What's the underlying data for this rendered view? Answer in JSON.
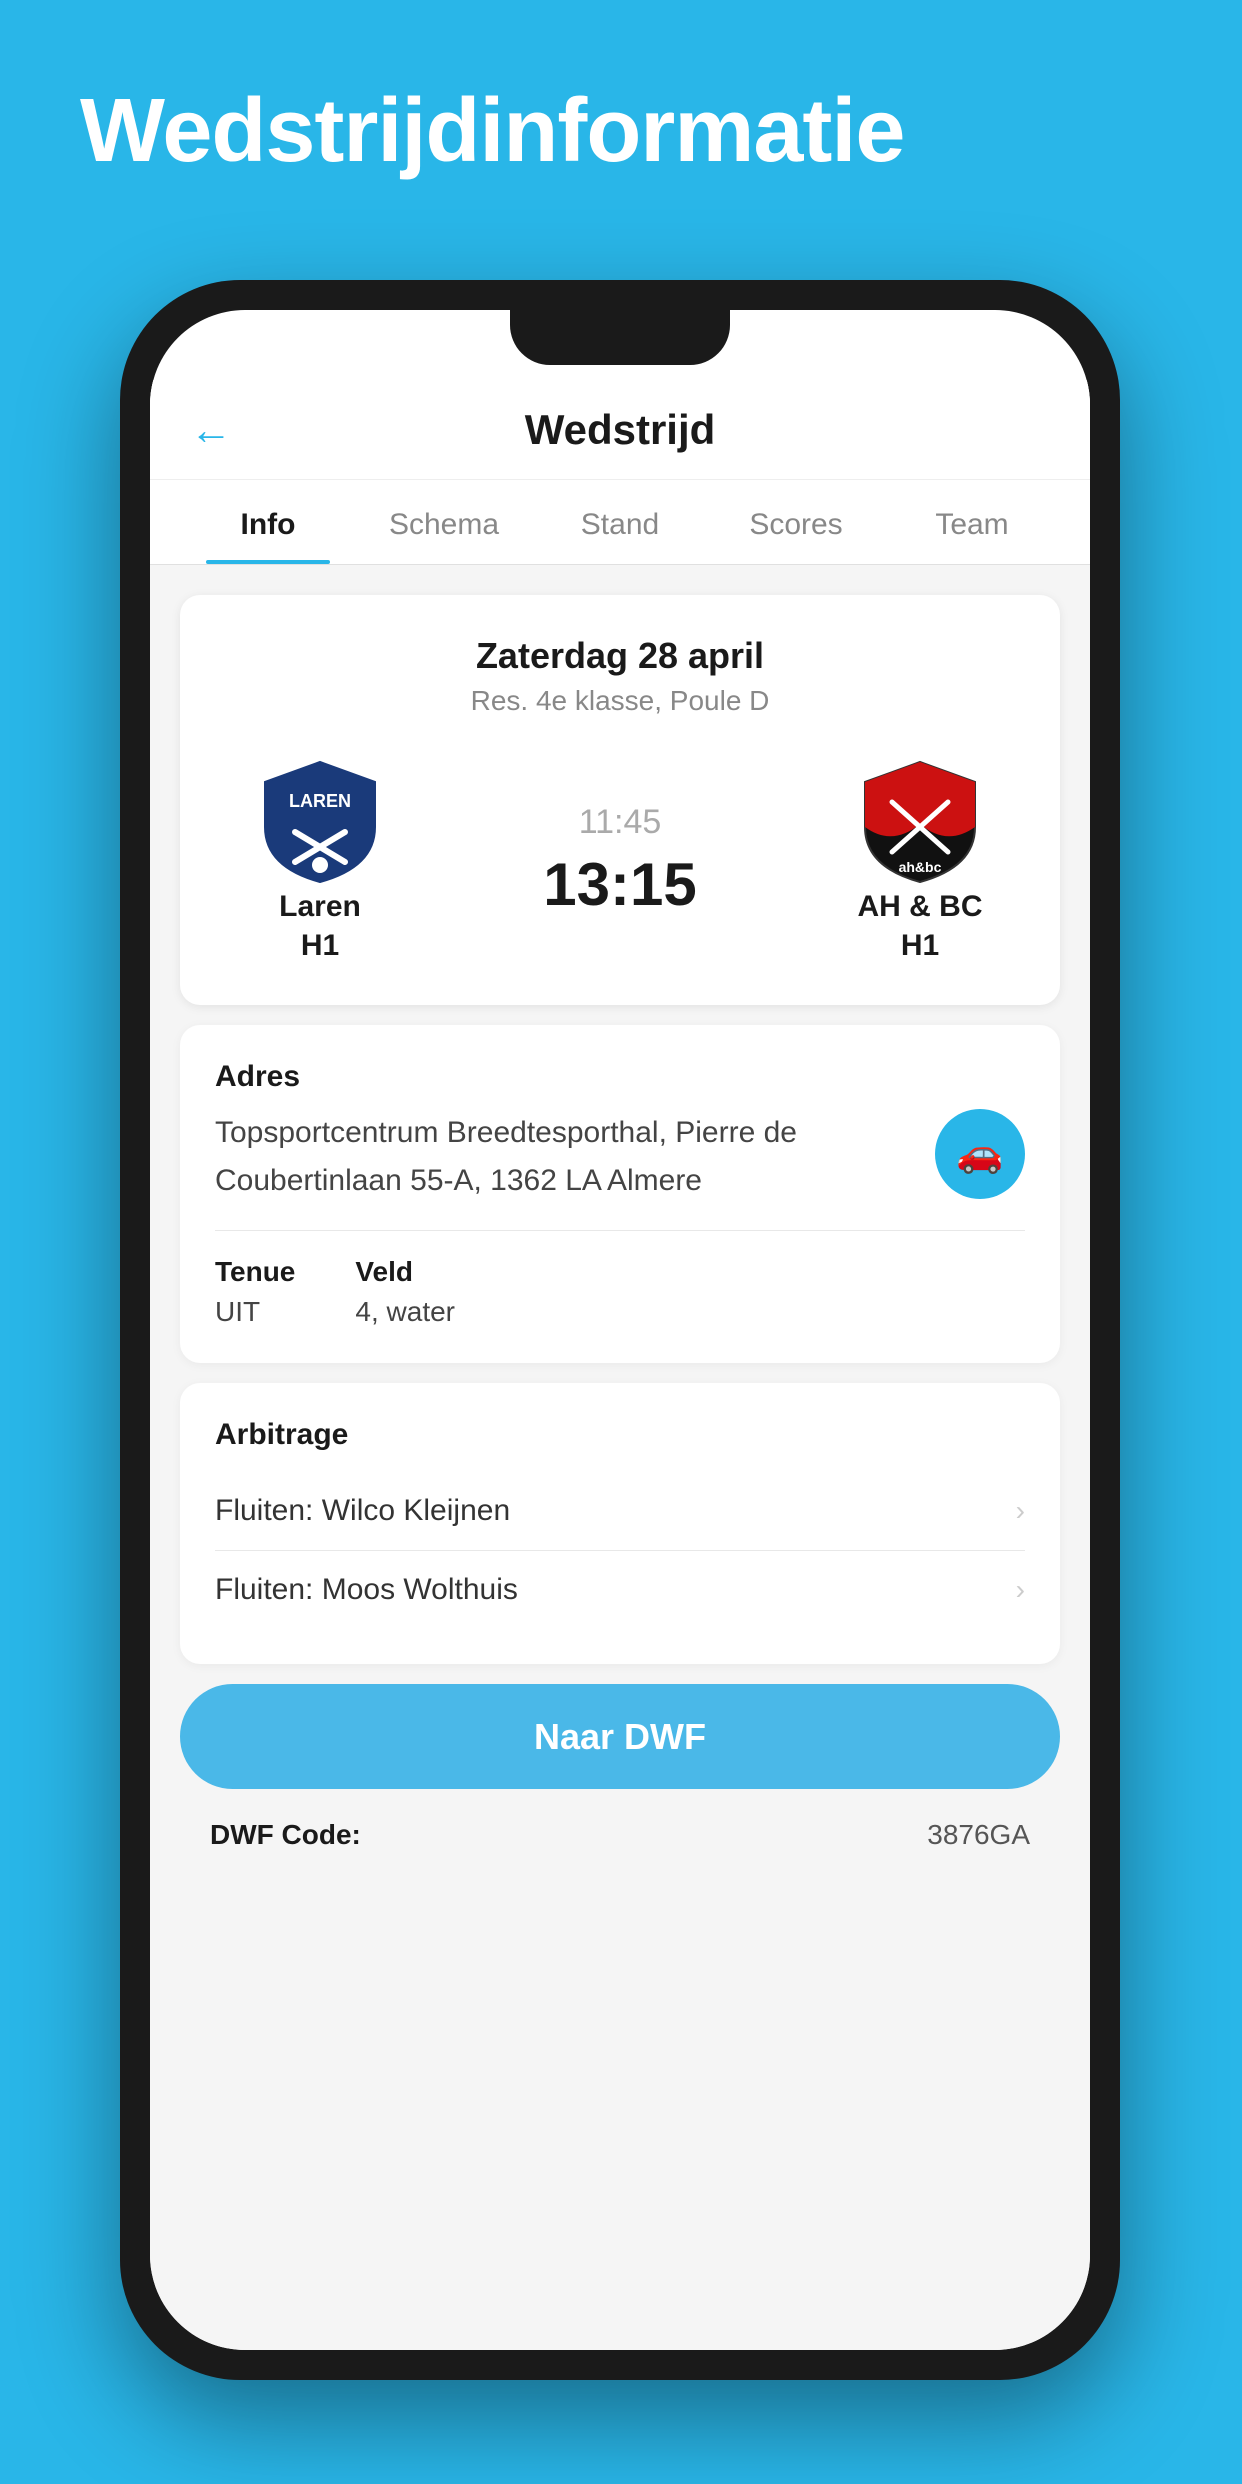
{
  "page": {
    "background_title": "Wedstrijdinformatie",
    "header": {
      "back_label": "←",
      "title": "Wedstrijd"
    },
    "tabs": [
      {
        "id": "info",
        "label": "Info",
        "active": true
      },
      {
        "id": "schema",
        "label": "Schema",
        "active": false
      },
      {
        "id": "stand",
        "label": "Stand",
        "active": false
      },
      {
        "id": "scores",
        "label": "Scores",
        "active": false
      },
      {
        "id": "team",
        "label": "Team",
        "active": false
      }
    ],
    "match": {
      "date": "Zaterdag 28 april",
      "league": "Res. 4e klasse, Poule D",
      "home_team": {
        "name": "Laren",
        "subtitle": "H1"
      },
      "away_team": {
        "name": "AH & BC",
        "subtitle": "H1"
      },
      "time": "11:45",
      "score": "13:15"
    },
    "info": {
      "address_label": "Adres",
      "address_text": "Topsportcentrum Breedtesporthal, Pierre de Coubertinlaan 55-A, 1362 LA Almere",
      "tenue_label": "Tenue",
      "tenue_value": "UIT",
      "veld_label": "Veld",
      "veld_value": "4, water"
    },
    "arbitrage": {
      "label": "Arbitrage",
      "items": [
        {
          "text": "Fluiten: Wilco Kleijnen"
        },
        {
          "text": "Fluiten: Moos Wolthuis"
        }
      ]
    },
    "dwf": {
      "button_label": "Naar DWF",
      "code_label": "DWF Code:",
      "code_value": "3876GA"
    }
  }
}
